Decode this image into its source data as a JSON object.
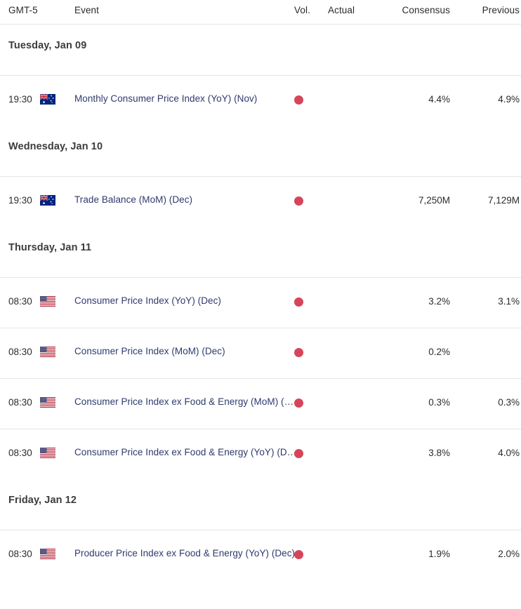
{
  "header": {
    "timezone_label": "GMT-5",
    "event_label": "Event",
    "volatility_label": "Vol.",
    "actual_label": "Actual",
    "consensus_label": "Consensus",
    "previous_label": "Previous"
  },
  "colors": {
    "link": "#2e3a6e",
    "volatility_high": "#d6455a",
    "text": "#2b2b2b",
    "day_header": "#3c3c3c",
    "separator": "#e2e4e7"
  },
  "days": [
    {
      "label": "Tuesday, Jan 09",
      "events": [
        {
          "time": "19:30",
          "flag": "au-flag-icon",
          "country": "Australia",
          "name": "Monthly Consumer Price Index (YoY) (Nov)",
          "volatility": "high",
          "actual": "",
          "consensus": "4.4%",
          "previous": "4.9%"
        }
      ]
    },
    {
      "label": "Wednesday, Jan 10",
      "events": [
        {
          "time": "19:30",
          "flag": "au-flag-icon",
          "country": "Australia",
          "name": "Trade Balance (MoM) (Dec)",
          "volatility": "high",
          "actual": "",
          "consensus": "7,250M",
          "previous": "7,129M"
        }
      ]
    },
    {
      "label": "Thursday, Jan 11",
      "events": [
        {
          "time": "08:30",
          "flag": "us-flag-icon",
          "country": "United States",
          "name": "Consumer Price Index (YoY) (Dec)",
          "volatility": "high",
          "actual": "",
          "consensus": "3.2%",
          "previous": "3.1%"
        },
        {
          "time": "08:30",
          "flag": "us-flag-icon",
          "country": "United States",
          "name": "Consumer Price Index (MoM) (Dec)",
          "volatility": "high",
          "actual": "",
          "consensus": "0.2%",
          "previous": ""
        },
        {
          "time": "08:30",
          "flag": "us-flag-icon",
          "country": "United States",
          "name": "Consumer Price Index ex Food & Energy (MoM) (Dec)",
          "volatility": "high",
          "actual": "",
          "consensus": "0.3%",
          "previous": "0.3%"
        },
        {
          "time": "08:30",
          "flag": "us-flag-icon",
          "country": "United States",
          "name": "Consumer Price Index ex Food & Energy (YoY) (Dec)",
          "volatility": "high",
          "actual": "",
          "consensus": "3.8%",
          "previous": "4.0%"
        }
      ]
    },
    {
      "label": "Friday, Jan 12",
      "events": [
        {
          "time": "08:30",
          "flag": "us-flag-icon",
          "country": "United States",
          "name": "Producer Price Index ex Food & Energy (YoY) (Dec)",
          "volatility": "high",
          "actual": "",
          "consensus": "1.9%",
          "previous": "2.0%"
        }
      ]
    }
  ]
}
